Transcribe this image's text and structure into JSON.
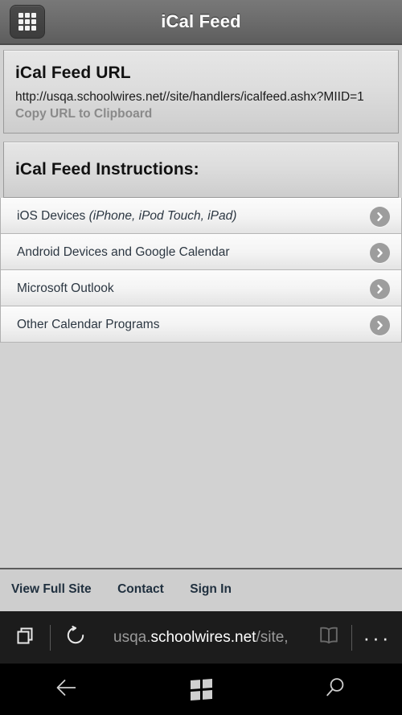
{
  "header": {
    "title": "iCal Feed",
    "menu_icon": "grid-menu-icon"
  },
  "url_panel": {
    "heading": "iCal Feed URL",
    "url": "http://usqa.schoolwires.net//site/handlers/icalfeed.ashx?MIID=1",
    "copy_label": "Copy URL to Clipboard"
  },
  "instructions_panel": {
    "heading": "iCal Feed Instructions:"
  },
  "list": {
    "items": [
      {
        "label": "iOS Devices ",
        "label_italic": "(iPhone, iPod Touch, iPad)",
        "chevron_icon": "chevron-right-icon"
      },
      {
        "label": "Android Devices and Google Calendar",
        "label_italic": "",
        "chevron_icon": "chevron-right-icon"
      },
      {
        "label": "Microsoft Outlook",
        "label_italic": "",
        "chevron_icon": "chevron-right-icon"
      },
      {
        "label": "Other Calendar Programs",
        "label_italic": "",
        "chevron_icon": "chevron-right-icon"
      }
    ]
  },
  "footer": {
    "links": [
      {
        "label": "View Full Site"
      },
      {
        "label": "Contact"
      },
      {
        "label": "Sign In"
      }
    ]
  },
  "browser": {
    "tabs_icon": "tabs-icon",
    "reload_icon": "reload-icon",
    "url_prefix": "usqa.",
    "url_host": "schoolwires.net",
    "url_path": "/site,",
    "reading_view_icon": "book-icon",
    "more_icon": "more-ellipsis-icon",
    "more_label": "···"
  },
  "nav": {
    "back_icon": "back-arrow-icon",
    "home_icon": "windows-logo-icon",
    "search_icon": "search-icon"
  },
  "colors": {
    "header_bg": "#6d6d6d",
    "page_bg": "#d2d2d2",
    "panel_bg": "#dddddd",
    "row_bg": "#f4f4f4",
    "chevron_bg": "#9d9d9d",
    "footer_bg": "#cecece",
    "chrome_bg": "#1c1c1c",
    "nav_bg": "#000000",
    "text_dark": "#2c3742",
    "text_muted": "#8a8a8a"
  }
}
